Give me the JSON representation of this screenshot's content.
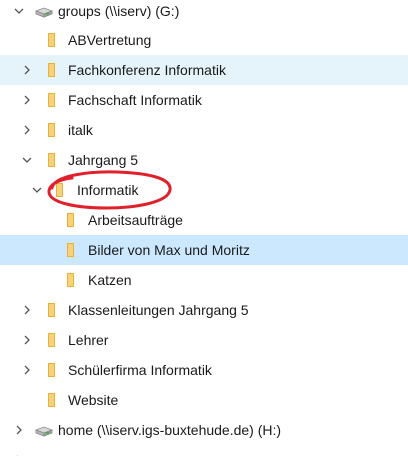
{
  "tree": {
    "drive_groups": {
      "label": "groups (\\\\iserv) (G:)",
      "icon": "network-drive-icon"
    },
    "abvertretung": {
      "label": "ABVertretung",
      "icon": "folder-icon"
    },
    "fachkonferenz": {
      "label": "Fachkonferenz Informatik",
      "icon": "folder-icon"
    },
    "fachschaft": {
      "label": "Fachschaft Informatik",
      "icon": "folder-icon"
    },
    "italk": {
      "label": "italk",
      "icon": "folder-icon"
    },
    "jahrgang5": {
      "label": "Jahrgang 5",
      "icon": "folder-icon"
    },
    "informatik": {
      "label": "Informatik",
      "icon": "folder-icon"
    },
    "arbeitsauftraege": {
      "label": "Arbeitsaufträge",
      "icon": "folder-icon"
    },
    "bilder": {
      "label": "Bilder von Max und Moritz",
      "icon": "folder-icon"
    },
    "katzen": {
      "label": "Katzen",
      "icon": "folder-icon"
    },
    "klassenleitungen": {
      "label": "Klassenleitungen Jahrgang 5",
      "icon": "folder-icon"
    },
    "lehrer": {
      "label": "Lehrer",
      "icon": "folder-icon"
    },
    "schuelerfirma": {
      "label": "Schülerfirma Informatik",
      "icon": "folder-icon"
    },
    "website": {
      "label": "Website",
      "icon": "folder-icon"
    },
    "drive_home": {
      "label": "home (\\\\iserv.igs-buxtehude.de) (H:)",
      "icon": "network-drive-icon"
    }
  },
  "colors": {
    "folder": "#e8b13c",
    "folder_light": "#f6d27a",
    "hover_background": "#e5f3fb",
    "selected_background": "#cce8ff",
    "annotation_circle": "#e0202a"
  }
}
